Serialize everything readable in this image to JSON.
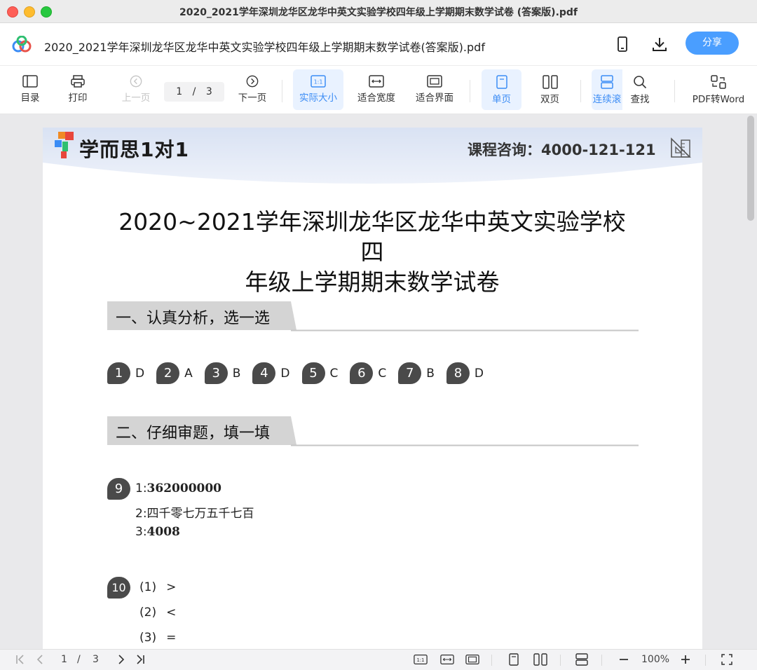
{
  "window": {
    "title": "2020_2021学年深圳龙华区龙华中英文实验学校四年级上学期期末数学试卷 (答案版).pdf"
  },
  "header": {
    "file_name": "2020_2021学年深圳龙华区龙华中英文实验学校四年级上学期期末数学试卷(答案版).pdf",
    "share_label": "分享",
    "icons": [
      "app-logo-icon",
      "phone-icon",
      "download-icon"
    ]
  },
  "toolbar": {
    "toc": "目录",
    "print": "打印",
    "prev": "上一页",
    "page_current": "1",
    "page_sep": "/",
    "page_total": "3",
    "next": "下一页",
    "actual_size": "实际大小",
    "fit_width": "适合宽度",
    "fit_page": "适合界面",
    "single_page": "单页",
    "double_page": "双页",
    "continuous": "连续滚",
    "find": "查找",
    "pdf_to_word": "PDF转Word",
    "accent": "#3b8cf5"
  },
  "document": {
    "brand": "学而思1对1",
    "hotline": "课程咨询：4000-121-121",
    "title_line1": "2020~2021学年深圳龙华区龙华中英文实验学校四",
    "title_line2": "年级上学期期末数学试卷",
    "section1": "一、认真分析，选一选",
    "answers": [
      {
        "num": "1",
        "val": "D"
      },
      {
        "num": "2",
        "val": "A"
      },
      {
        "num": "3",
        "val": "B"
      },
      {
        "num": "4",
        "val": "D"
      },
      {
        "num": "5",
        "val": "C"
      },
      {
        "num": "6",
        "val": "C"
      },
      {
        "num": "7",
        "val": "B"
      },
      {
        "num": "8",
        "val": "D"
      }
    ],
    "section2": "二、仔细审题，填一填",
    "q9": {
      "num": "9",
      "l1_prefix": "1:",
      "l1_value": "362000000",
      "l2_prefix": "2:",
      "l2_value": "四千零七万五千七百",
      "l3_prefix": "3:",
      "l3_value": "4008"
    },
    "q10": {
      "num": "10",
      "items": [
        {
          "label": "(1)",
          "sym": ">"
        },
        {
          "label": "(2)",
          "sym": "<"
        },
        {
          "label": "(3)",
          "sym": "="
        }
      ]
    }
  },
  "statusbar": {
    "page_current": "1",
    "page_sep": "/",
    "page_total": "3",
    "zoom": "100%"
  }
}
